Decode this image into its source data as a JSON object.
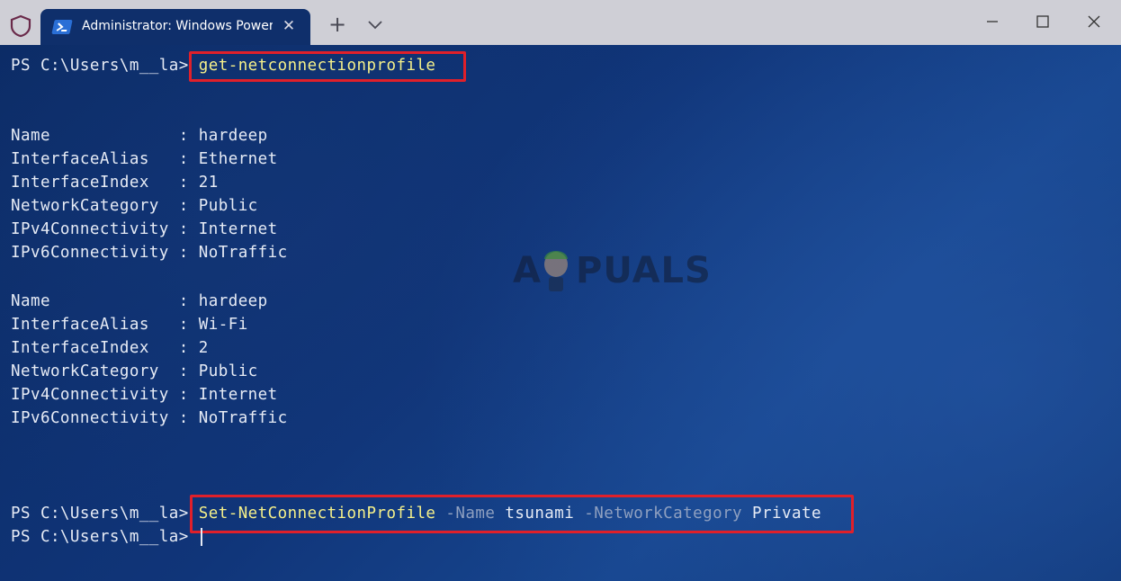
{
  "titlebar": {
    "tab_title": "Administrator: Windows PowerShell",
    "close_glyph": "✕",
    "new_tab_glyph": "+"
  },
  "terminal": {
    "prompt": "PS C:\\Users\\m__la>",
    "command1": "get-netconnectionprofile",
    "profiles": [
      {
        "rows": [
          {
            "key": "Name            ",
            "value": "hardeep"
          },
          {
            "key": "InterfaceAlias  ",
            "value": "Ethernet"
          },
          {
            "key": "InterfaceIndex  ",
            "value": "21"
          },
          {
            "key": "NetworkCategory ",
            "value": "Public"
          },
          {
            "key": "IPv4Connectivity",
            "value": "Internet"
          },
          {
            "key": "IPv6Connectivity",
            "value": "NoTraffic"
          }
        ]
      },
      {
        "rows": [
          {
            "key": "Name            ",
            "value": "hardeep"
          },
          {
            "key": "InterfaceAlias  ",
            "value": "Wi-Fi"
          },
          {
            "key": "InterfaceIndex  ",
            "value": "2"
          },
          {
            "key": "NetworkCategory ",
            "value": "Public"
          },
          {
            "key": "IPv4Connectivity",
            "value": "Internet"
          },
          {
            "key": "IPv6Connectivity",
            "value": "NoTraffic"
          }
        ]
      }
    ],
    "command2": {
      "cmdlet": "Set-NetConnectionProfile",
      "param1": "-Name",
      "arg1": "tsunami",
      "param2": "-NetworkCategory",
      "arg2": "Private"
    },
    "highlight_color": "#e0202a",
    "command_color": "#f5f08a"
  },
  "watermark": {
    "text_left": "A",
    "text_right": "PUALS"
  }
}
